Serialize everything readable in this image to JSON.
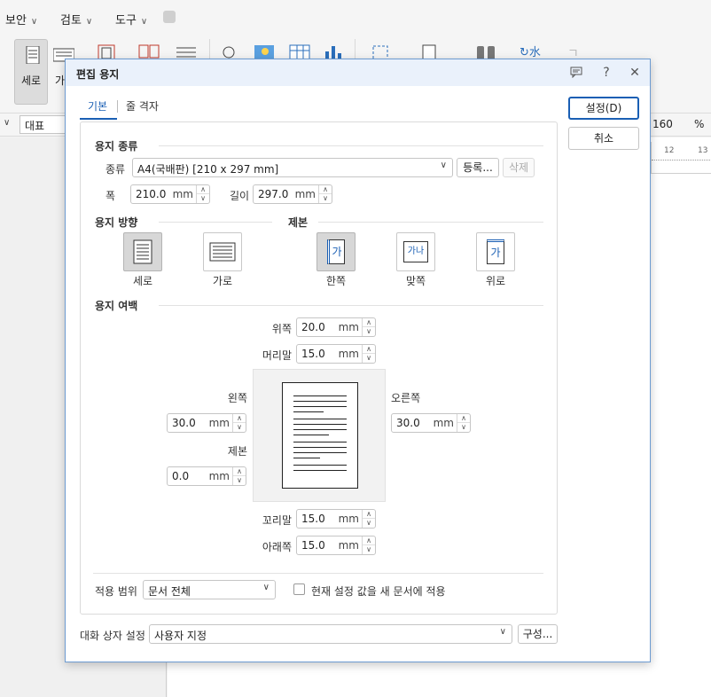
{
  "menubar": {
    "items": [
      "보안",
      "검토",
      "도구"
    ]
  },
  "ribbon": {
    "portrait_label": "세로",
    "landscape_label_partial": "가"
  },
  "format_bar": {
    "style_value": "대표",
    "zoom_value": "160",
    "zoom_unit": "%"
  },
  "ruler": {
    "ticks": [
      "12",
      "13"
    ]
  },
  "dialog": {
    "title": "편집 용지",
    "tabs": [
      {
        "label": "기본"
      },
      {
        "label": "줄 격자"
      }
    ],
    "buttons": {
      "ok": "설정(D)",
      "cancel": "취소"
    },
    "paper_type": {
      "section": "용지 종류",
      "kind_label": "종류",
      "kind_value": "A4(국배판) [210 x 297 mm]",
      "register_button": "등록...",
      "delete_button": "삭제",
      "width_label": "폭",
      "width_value": "210.0",
      "width_unit": "mm",
      "length_label": "길이",
      "length_value": "297.0",
      "length_unit": "mm"
    },
    "orientation": {
      "section": "용지 방향",
      "portrait": "세로",
      "landscape": "가로"
    },
    "binding": {
      "section": "제본",
      "one_side": "한쪽",
      "facing": "맞쪽",
      "top": "위로",
      "icon_glyph": "가",
      "facing_glyph": "가나"
    },
    "margins": {
      "section": "용지 여백",
      "top_label": "위쪽",
      "top_value": "20.0",
      "header_label": "머리말",
      "header_value": "15.0",
      "left_label": "왼쪽",
      "left_value": "30.0",
      "right_label": "오른쪽",
      "right_value": "30.0",
      "gutter_label": "제본",
      "gutter_value": "0.0",
      "footer_label": "꼬리말",
      "footer_value": "15.0",
      "bottom_label": "아래쪽",
      "bottom_value": "15.0",
      "unit": "mm"
    },
    "apply": {
      "label": "적용 범위",
      "value": "문서 전체",
      "checkbox_label": "현재 설정 값을 새 문서에 적용",
      "checked": false
    },
    "dialog_settings": {
      "label": "대화 상자 설정",
      "value": "사용자 지정",
      "config_button": "구성..."
    }
  },
  "colors": {
    "accent": "#1a5fb4",
    "titlebar": "#eaf1fb",
    "dialog_border": "#6d9bd1"
  }
}
